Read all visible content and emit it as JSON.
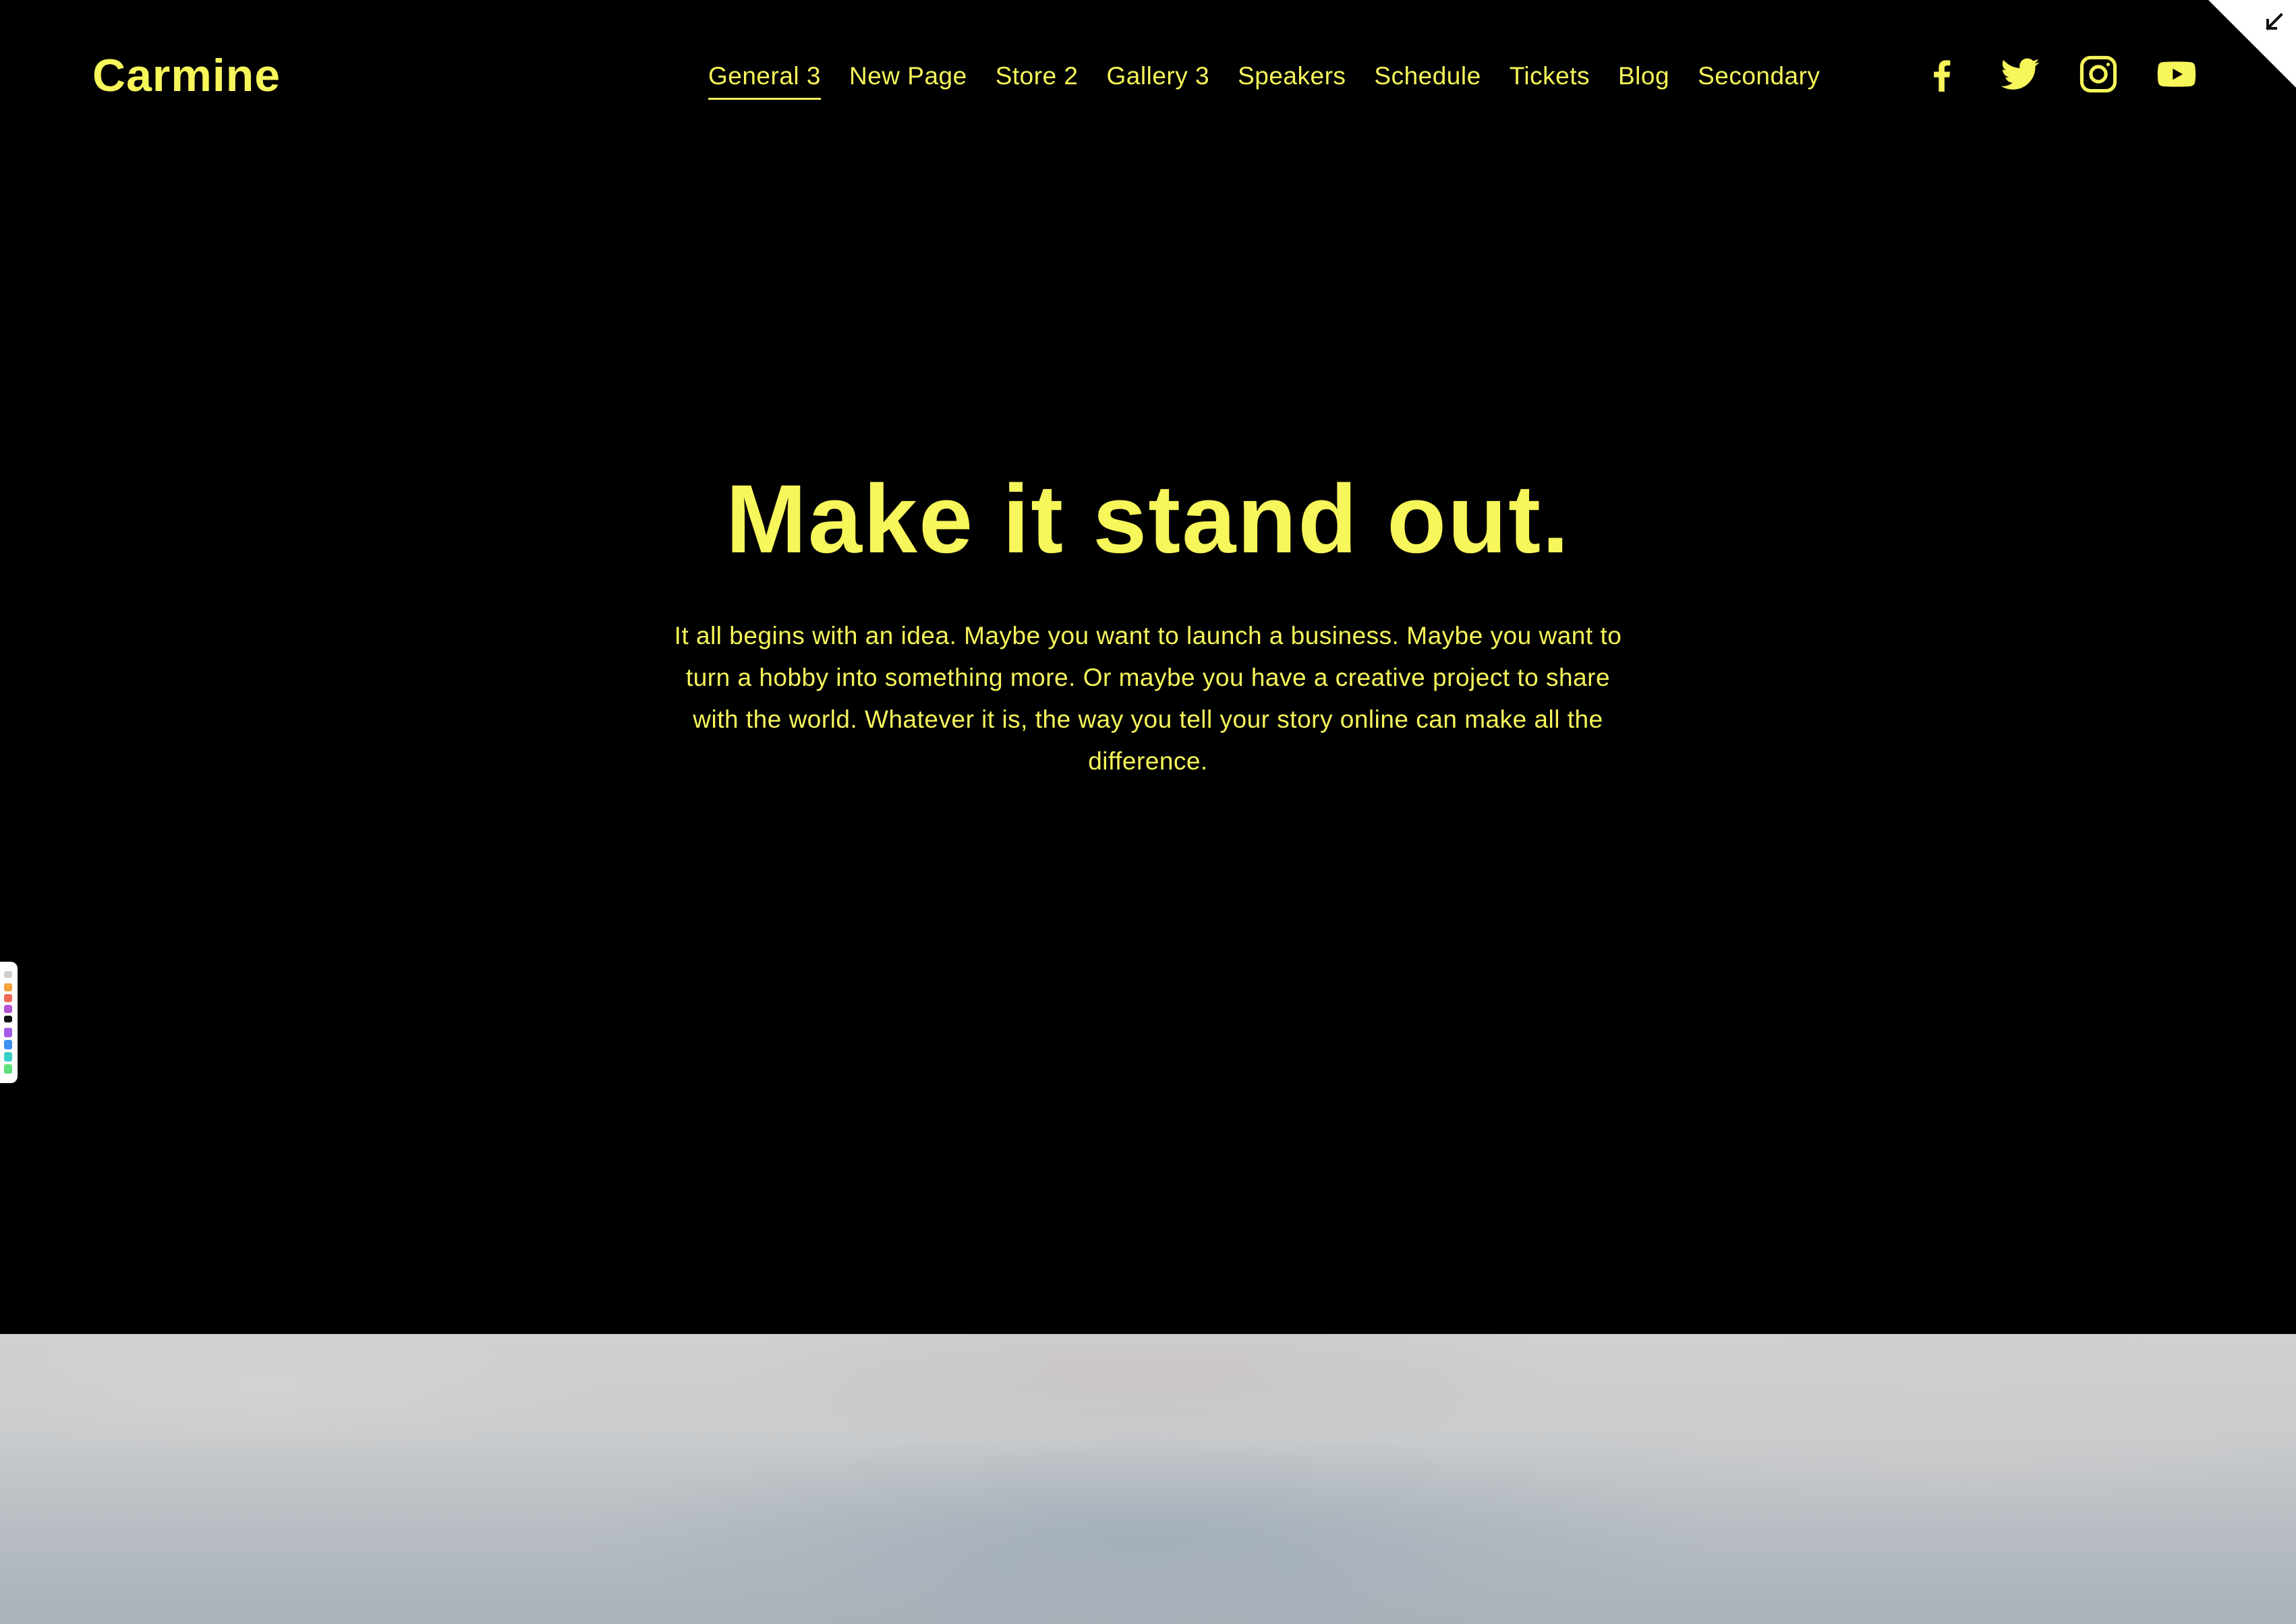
{
  "site": {
    "logo": "Carmine",
    "accent_color": "#f7f65a",
    "background_color": "#000000"
  },
  "nav": {
    "items": [
      {
        "label": "General 3",
        "active": true
      },
      {
        "label": "New Page",
        "active": false
      },
      {
        "label": "Store 2",
        "active": false
      },
      {
        "label": "Gallery 3",
        "active": false
      },
      {
        "label": "Speakers",
        "active": false
      },
      {
        "label": "Schedule",
        "active": false
      },
      {
        "label": "Tickets",
        "active": false
      },
      {
        "label": "Blog",
        "active": false
      },
      {
        "label": "Secondary",
        "active": false
      }
    ]
  },
  "social": {
    "icons": [
      "facebook-icon",
      "twitter-icon",
      "instagram-icon",
      "youtube-icon"
    ]
  },
  "corner_toggle": {
    "icon": "collapse-arrow-icon"
  },
  "hero": {
    "headline": "Make it stand out.",
    "body": "It all begins with an idea. Maybe you want to launch a business. Maybe you want to turn a hobby into something more. Or maybe you have a creative project to share with the world. Whatever it is, the way you tell your story online can make all the difference."
  }
}
